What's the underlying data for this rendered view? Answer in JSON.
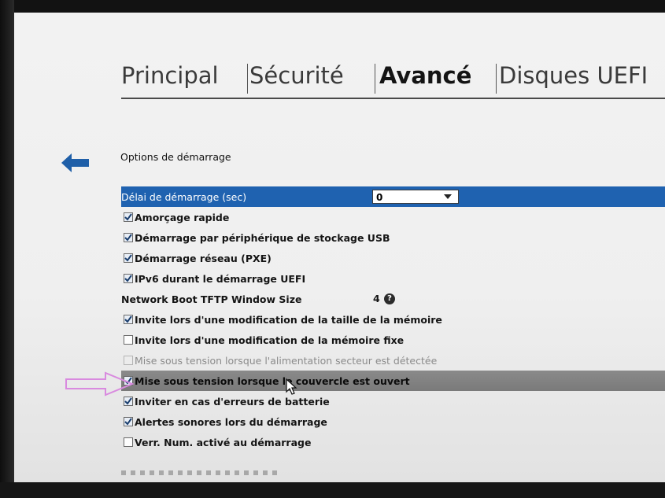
{
  "tabs": [
    {
      "label": "Principal",
      "active": false
    },
    {
      "label": "Sécurité",
      "active": false
    },
    {
      "label": "Avancé",
      "active": true
    },
    {
      "label": "Disques UEFI",
      "active": false
    }
  ],
  "back_icon": "left-arrow-icon",
  "section": {
    "title": "Options de démarrage"
  },
  "rows": [
    {
      "label": "Délai de démarrage (sec)",
      "type": "dropdown",
      "value": "0",
      "selected": true
    },
    {
      "label": "Amorçage rapide",
      "type": "checkbox",
      "checked": true
    },
    {
      "label": "Démarrage par périphérique de stockage USB",
      "type": "checkbox",
      "checked": true
    },
    {
      "label": "Démarrage réseau (PXE)",
      "type": "checkbox",
      "checked": true
    },
    {
      "label": "IPv6 durant le démarrage UEFI",
      "type": "checkbox",
      "checked": true
    },
    {
      "label": "Network Boot TFTP Window Size",
      "type": "value",
      "value": "4",
      "help_icon": "question-mark-icon"
    },
    {
      "label": "Invite lors d'une modification de la taille de la mémoire",
      "type": "checkbox",
      "checked": true
    },
    {
      "label": "Invite lors d'une modification de la mémoire fixe",
      "type": "checkbox",
      "checked": false
    },
    {
      "label": "Mise sous tension lorsque l'alimentation secteur est détectée",
      "type": "checkbox",
      "checked": false,
      "disabled": true
    },
    {
      "label": "Mise sous tension lorsque le couvercle est ouvert",
      "type": "checkbox",
      "checked": true,
      "highlighted": true
    },
    {
      "label": "Inviter en cas d'erreurs de batterie",
      "type": "checkbox",
      "checked": true
    },
    {
      "label": "Alertes sonores lors du démarrage",
      "type": "checkbox",
      "checked": true
    },
    {
      "label": "Verr. Num. activé au démarrage",
      "type": "checkbox",
      "checked": false
    }
  ],
  "colors": {
    "selection_blue": "#1f62b0",
    "hover_gray": "#808080",
    "annotation_pink": "#d98adf"
  }
}
